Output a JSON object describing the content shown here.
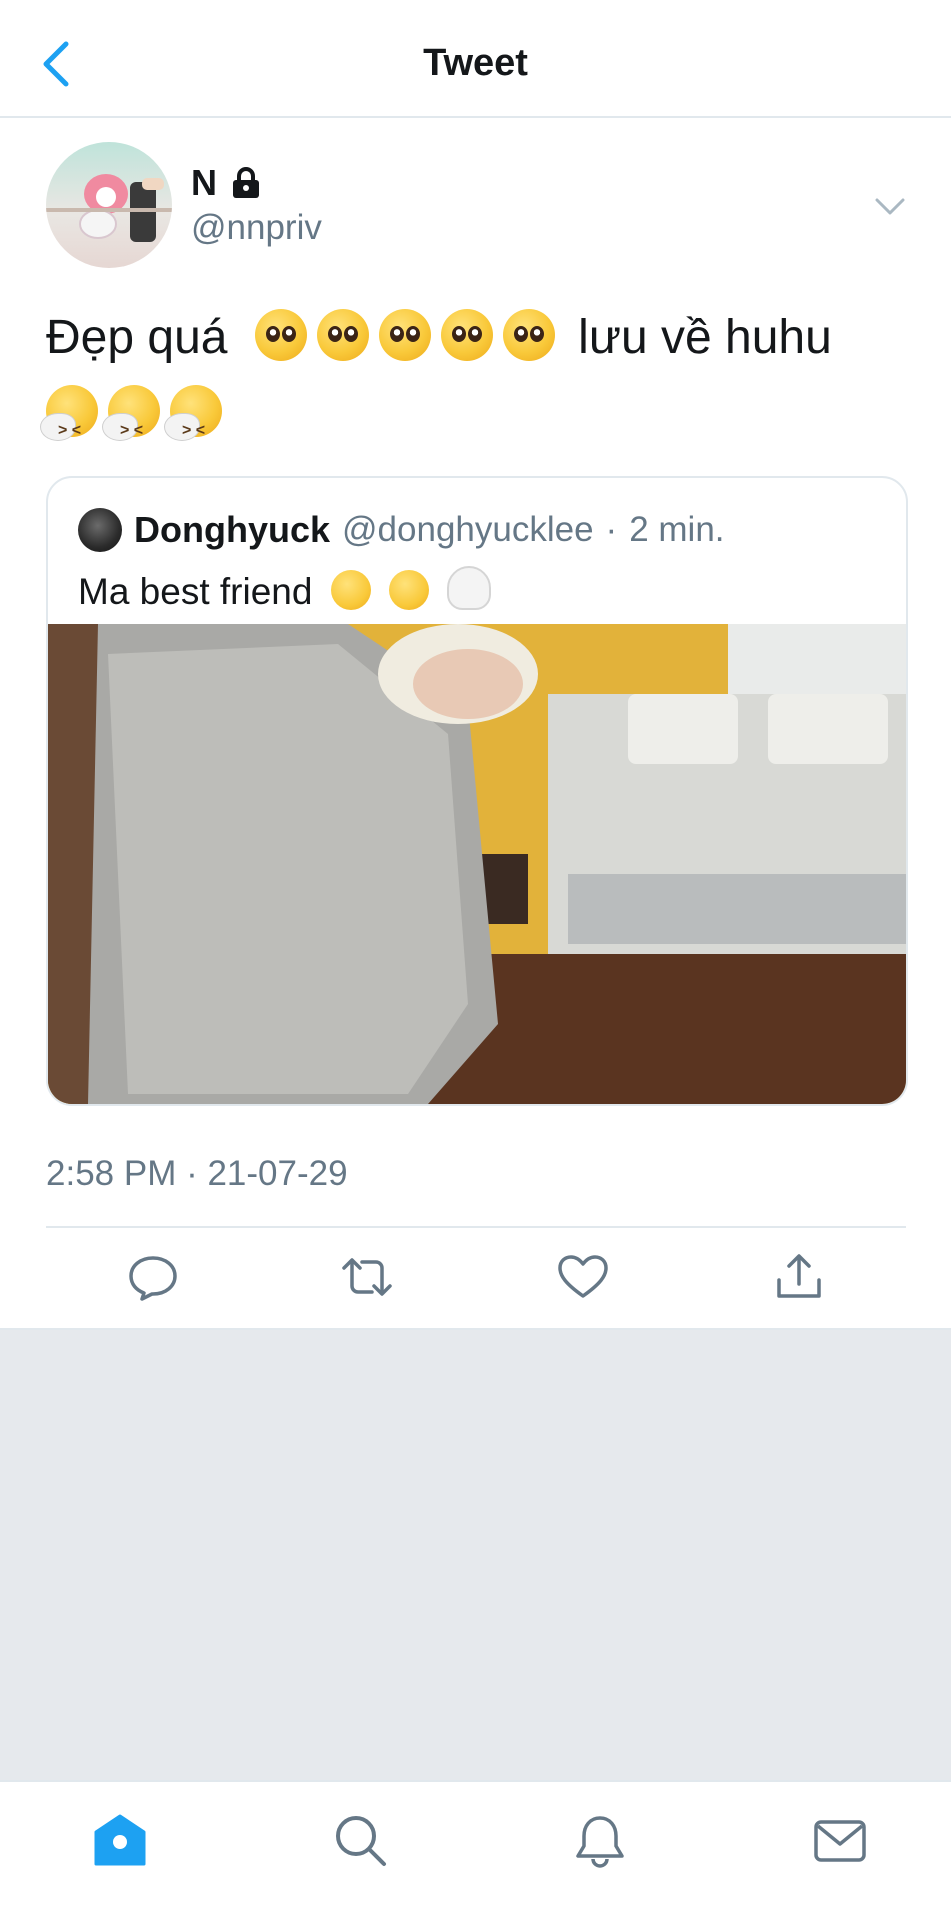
{
  "header": {
    "title": "Tweet",
    "back_icon": "chevron-left-icon"
  },
  "tweet": {
    "display_name": "N",
    "handle": "@nnpriv",
    "text_part1": "Đẹp quá",
    "text_part2": "lưu về huhu",
    "timestamp": "2:58 PM · 21-07-29"
  },
  "quote": {
    "name": "Donghyuck",
    "handle": "@donghyucklee",
    "separator": "·",
    "time": "2 min.",
    "text": "Ma best friend"
  },
  "actions": [
    "reply-icon",
    "retweet-icon",
    "like-icon",
    "share-icon"
  ],
  "tabbar": [
    "home-icon",
    "search-icon",
    "notifications-icon",
    "messages-icon"
  ],
  "colors": {
    "accent": "#1da1f2",
    "secondary_text": "#657786",
    "border": "#e1e8ed",
    "background_gray": "#e6e9ed"
  }
}
